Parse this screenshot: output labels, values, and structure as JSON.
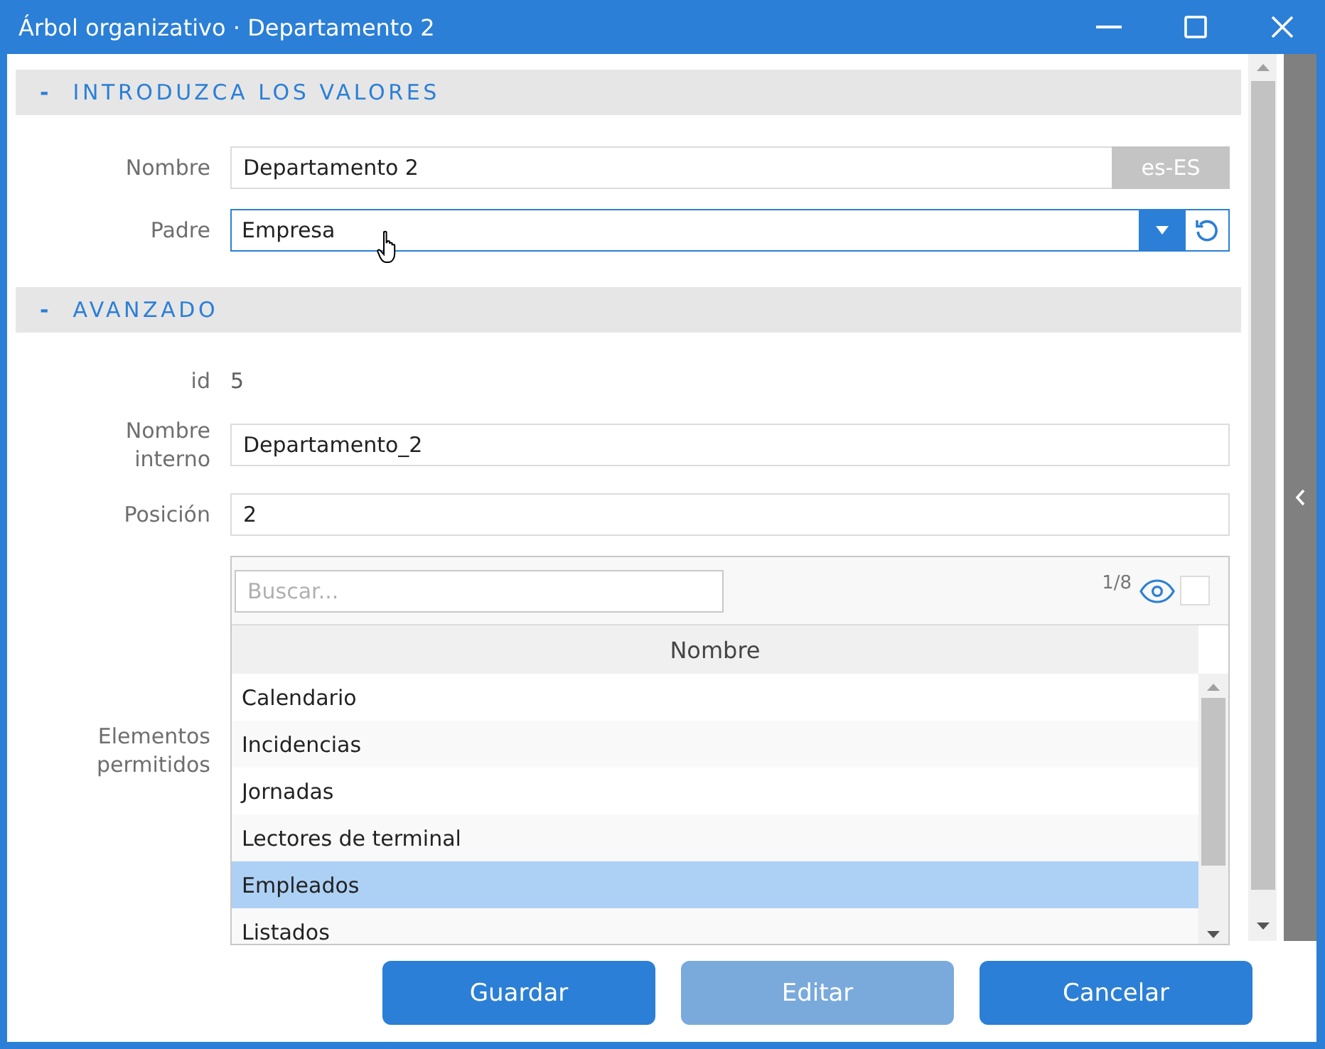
{
  "window": {
    "title": "Árbol organizativo · Departamento 2"
  },
  "sections": [
    {
      "toggle": "-",
      "title": "INTRODUZCA LOS VALORES",
      "fields": [
        {
          "kind": "text",
          "label": "Nombre",
          "value": "Departamento 2",
          "locale": "es-ES"
        },
        {
          "kind": "select",
          "label": "Padre",
          "value": "Empresa"
        }
      ]
    },
    {
      "toggle": "-",
      "title": "AVANZADO",
      "fields": [
        {
          "kind": "static",
          "label": "id",
          "value": "5"
        },
        {
          "kind": "text",
          "label": "Nombre interno",
          "value": "Departamento_2"
        },
        {
          "kind": "text",
          "label": "Posición",
          "value": "2"
        },
        {
          "kind": "list",
          "label": "Elementos permitidos",
          "search": {
            "placeholder": "Buscar..."
          },
          "counter": "1/8",
          "checkbox": {
            "checked": false
          },
          "column": "Nombre",
          "rows": [
            {
              "label": "Calendario",
              "selected": false
            },
            {
              "label": "Incidencias",
              "selected": false
            },
            {
              "label": "Jornadas",
              "selected": false
            },
            {
              "label": "Lectores de terminal",
              "selected": false
            },
            {
              "label": "Empleados",
              "selected": true
            },
            {
              "label": "Listados",
              "selected": false
            }
          ]
        }
      ]
    }
  ],
  "buttons": [
    {
      "label": "Guardar",
      "disabled": false
    },
    {
      "label": "Editar",
      "disabled": true
    },
    {
      "label": "Cancelar",
      "disabled": false
    }
  ]
}
